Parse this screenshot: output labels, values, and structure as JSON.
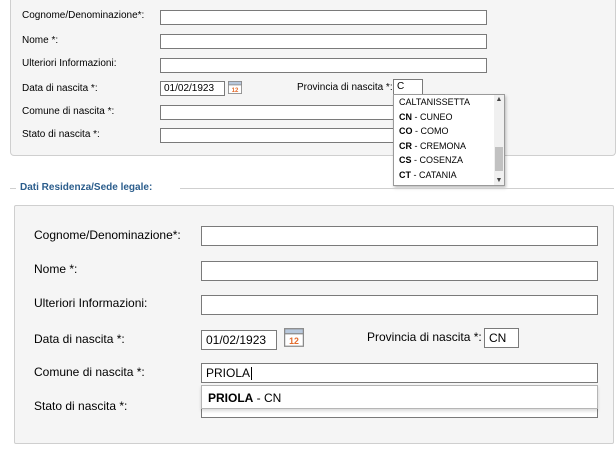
{
  "top": {
    "labels": {
      "cognome": "Cognome/Denominazione*:",
      "nome": "Nome *:",
      "ulteriori": "Ulteriori Informazioni:",
      "data_nascita": "Data di nascita *:",
      "provincia": "Provincia di nascita *:",
      "comune": "Comune di nascita *:",
      "stato": "Stato di nascita *:"
    },
    "values": {
      "data_nascita": "01/02/1923",
      "provincia": "C"
    },
    "section_legend": "Dati Residenza/Sede legale:",
    "calendar_day": "12",
    "dropdown": {
      "items": [
        {
          "code": "",
          "sep": "",
          "name": "CALTANISSETTA"
        },
        {
          "code": "CN",
          "sep": " - ",
          "name": "CUNEO"
        },
        {
          "code": "CO",
          "sep": " - ",
          "name": "COMO"
        },
        {
          "code": "CR",
          "sep": " - ",
          "name": "CREMONA"
        },
        {
          "code": "CS",
          "sep": " - ",
          "name": "COSENZA"
        },
        {
          "code": "CT",
          "sep": " - ",
          "name": "CATANIA"
        }
      ],
      "scroll_up_icon": "▲",
      "scroll_down_icon": "▼"
    }
  },
  "bottom": {
    "labels": {
      "cognome": "Cognome/Denominazione*:",
      "nome": "Nome *:",
      "ulteriori": "Ulteriori Informazioni:",
      "data_nascita": "Data di nascita *:",
      "provincia": "Provincia di nascita *:",
      "comune": "Comune di nascita *:",
      "stato": "Stato di nascita *:"
    },
    "values": {
      "data_nascita": "01/02/1923",
      "provincia": "CN",
      "comune": "PRIOLA"
    },
    "calendar_day": "12",
    "autocomplete": {
      "bold": "PRIOLA",
      "rest": " - CN"
    }
  },
  "colors": {
    "panel_bg": "#f5f5f5",
    "legend": "#2b5d8c",
    "calendar_red": "#e36b2c"
  }
}
